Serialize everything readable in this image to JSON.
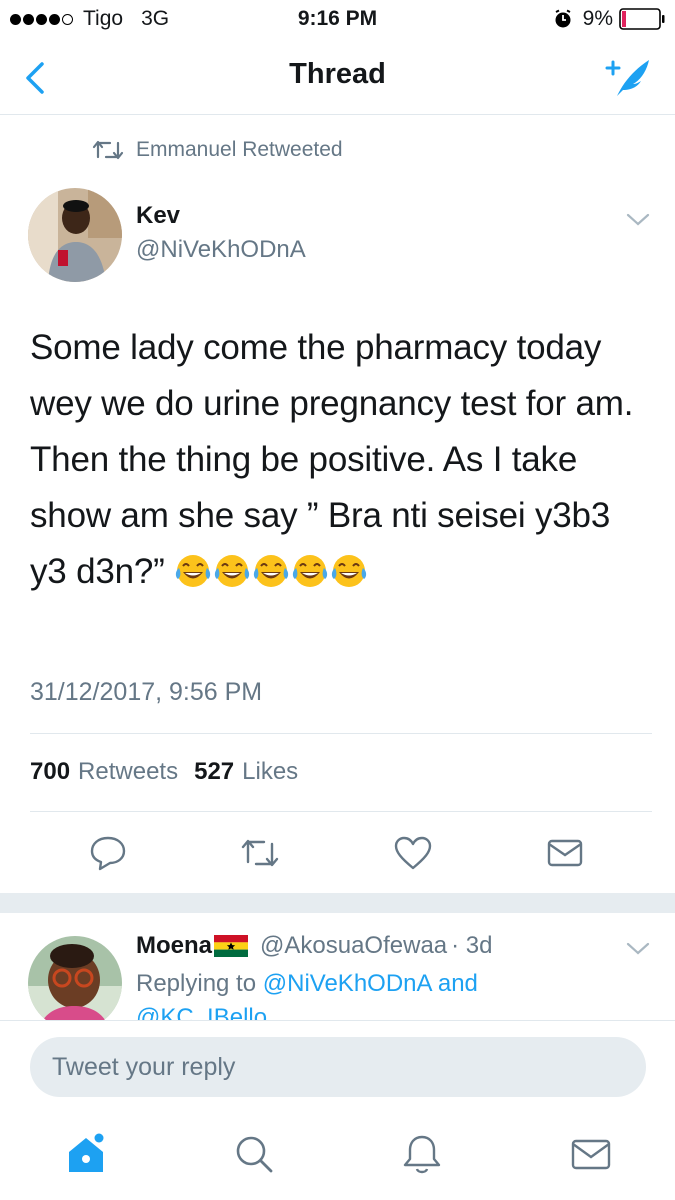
{
  "status_bar": {
    "carrier": "Tigo",
    "network": "3G",
    "time": "9:16 PM",
    "battery": "9%",
    "icons": [
      "signal-dots-icon",
      "alarm-icon",
      "battery-icon"
    ]
  },
  "nav": {
    "title": "Thread",
    "back_icon": "chevron-left-icon",
    "compose_icon": "compose-tweet-icon"
  },
  "tweet": {
    "retweeted_by": "Emmanuel Retweeted",
    "author_name": "Kev",
    "author_handle": "@NiVeKhODnA",
    "text": "Some lady come the pharmacy today wey we do urine pregnancy test for am. Then the thing be positive. As I take show am she say ” Bra nti seisei y3b3 y3 d3n?”",
    "emoji": [
      "face-with-tears-of-joy",
      "face-with-tears-of-joy",
      "face-with-tears-of-joy",
      "face-with-tears-of-joy",
      "face-with-tears-of-joy"
    ],
    "timestamp": "31/12/2017, 9:56 PM",
    "retweets_count": "700",
    "retweets_label": "Retweets",
    "likes_count": "527",
    "likes_label": "Likes",
    "actions": [
      "reply-icon",
      "retweet-icon",
      "like-icon",
      "direct-message-icon"
    ]
  },
  "reply": {
    "name": "Moena",
    "flag": "ghana-flag",
    "handle": "@AkosuaOfewaa",
    "time": "· 3d",
    "replying_prefix": "Replying to",
    "replying_to": "@NiVeKhODnA and",
    "replying_to_2": "@KC_IBello"
  },
  "composer": {
    "placeholder": "Tweet your reply"
  },
  "tab_bar": {
    "tabs": [
      "home-icon",
      "search-icon",
      "notifications-icon",
      "messages-icon"
    ],
    "active_color": "#1da1f2"
  },
  "colors": {
    "accent": "#1da1f2",
    "secondary_text": "#657786",
    "divider": "#e1e8ed",
    "battery_low": "#e0245e"
  }
}
